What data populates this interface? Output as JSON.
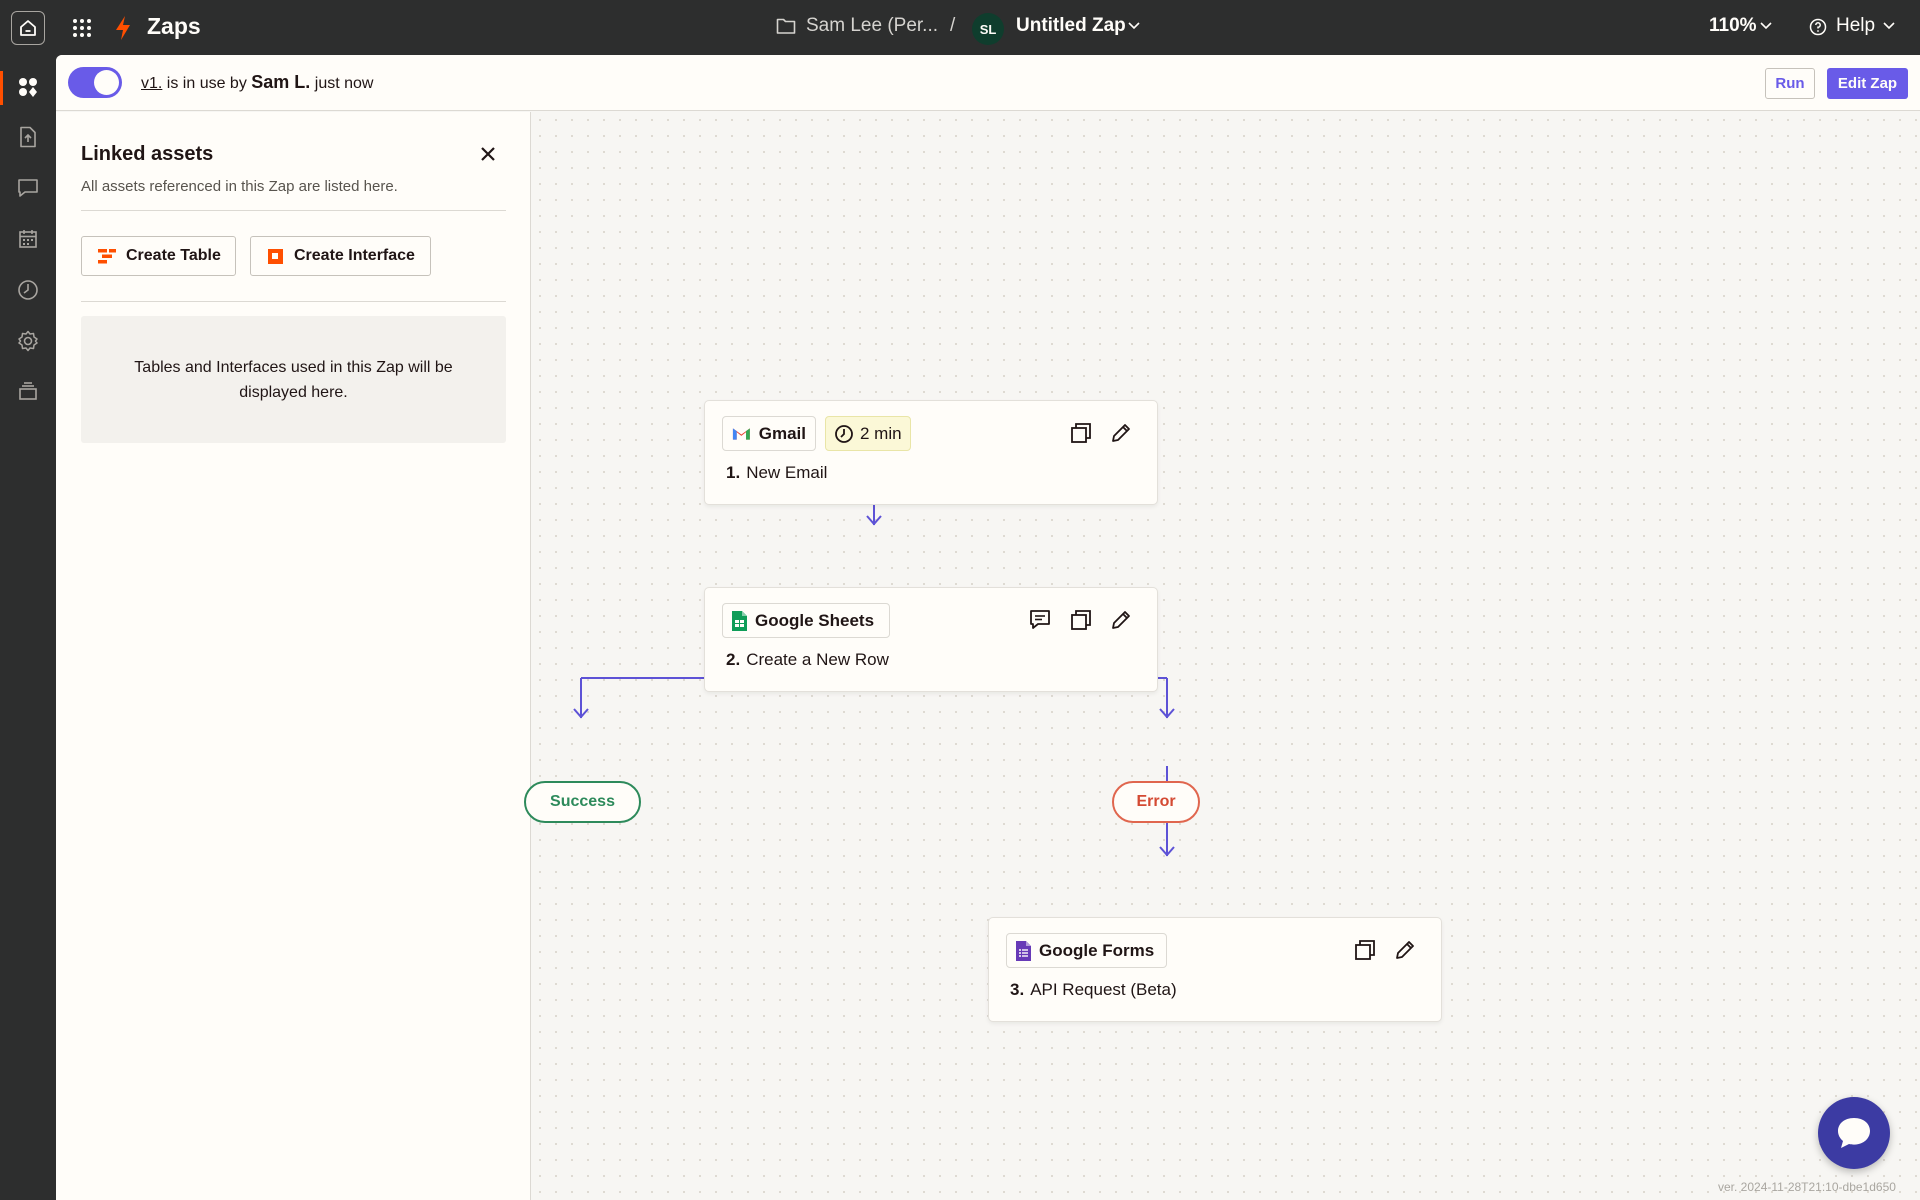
{
  "topbar": {
    "app_title": "Zaps",
    "folder": "Sam Lee (Per...",
    "separator": "/",
    "avatar_initials": "SL",
    "zap_name": "Untitled Zap",
    "zoom": "110%",
    "help": "Help"
  },
  "status": {
    "version_link": "v1.",
    "middle": " is in use by ",
    "user": "Sam L.",
    "when": " just now",
    "run_label": "Run",
    "edit_label": "Edit Zap",
    "toggle_on": true
  },
  "panel": {
    "title": "Linked assets",
    "subtitle": "All assets referenced in this Zap are listed here.",
    "create_table": "Create Table",
    "create_interface": "Create Interface",
    "empty_message": "Tables and Interfaces used in this Zap will be displayed here."
  },
  "steps": [
    {
      "app": "Gmail",
      "number": "1.",
      "label": "New Email",
      "badge": "2 min"
    },
    {
      "app": "Google Sheets",
      "number": "2.",
      "label": "Create a New Row"
    },
    {
      "app": "Google Forms",
      "number": "3.",
      "label": "API Request (Beta)"
    }
  ],
  "branches": {
    "success": "Success",
    "error": "Error"
  },
  "footer": {
    "build_version": "ver. 2024-11-28T21:10-dbe1d650"
  },
  "colors": {
    "accent": "#695be8",
    "brand_orange": "#ff4f00",
    "success": "#2d8a5b",
    "error": "#e0664e",
    "wire": "#5d52d6",
    "topbar": "#2d2e2e"
  },
  "icons": {
    "rail": [
      "zaps-icon",
      "file-upload-icon",
      "chat-icon",
      "calendar-icon",
      "history-icon",
      "settings-icon",
      "archive-icon"
    ]
  }
}
